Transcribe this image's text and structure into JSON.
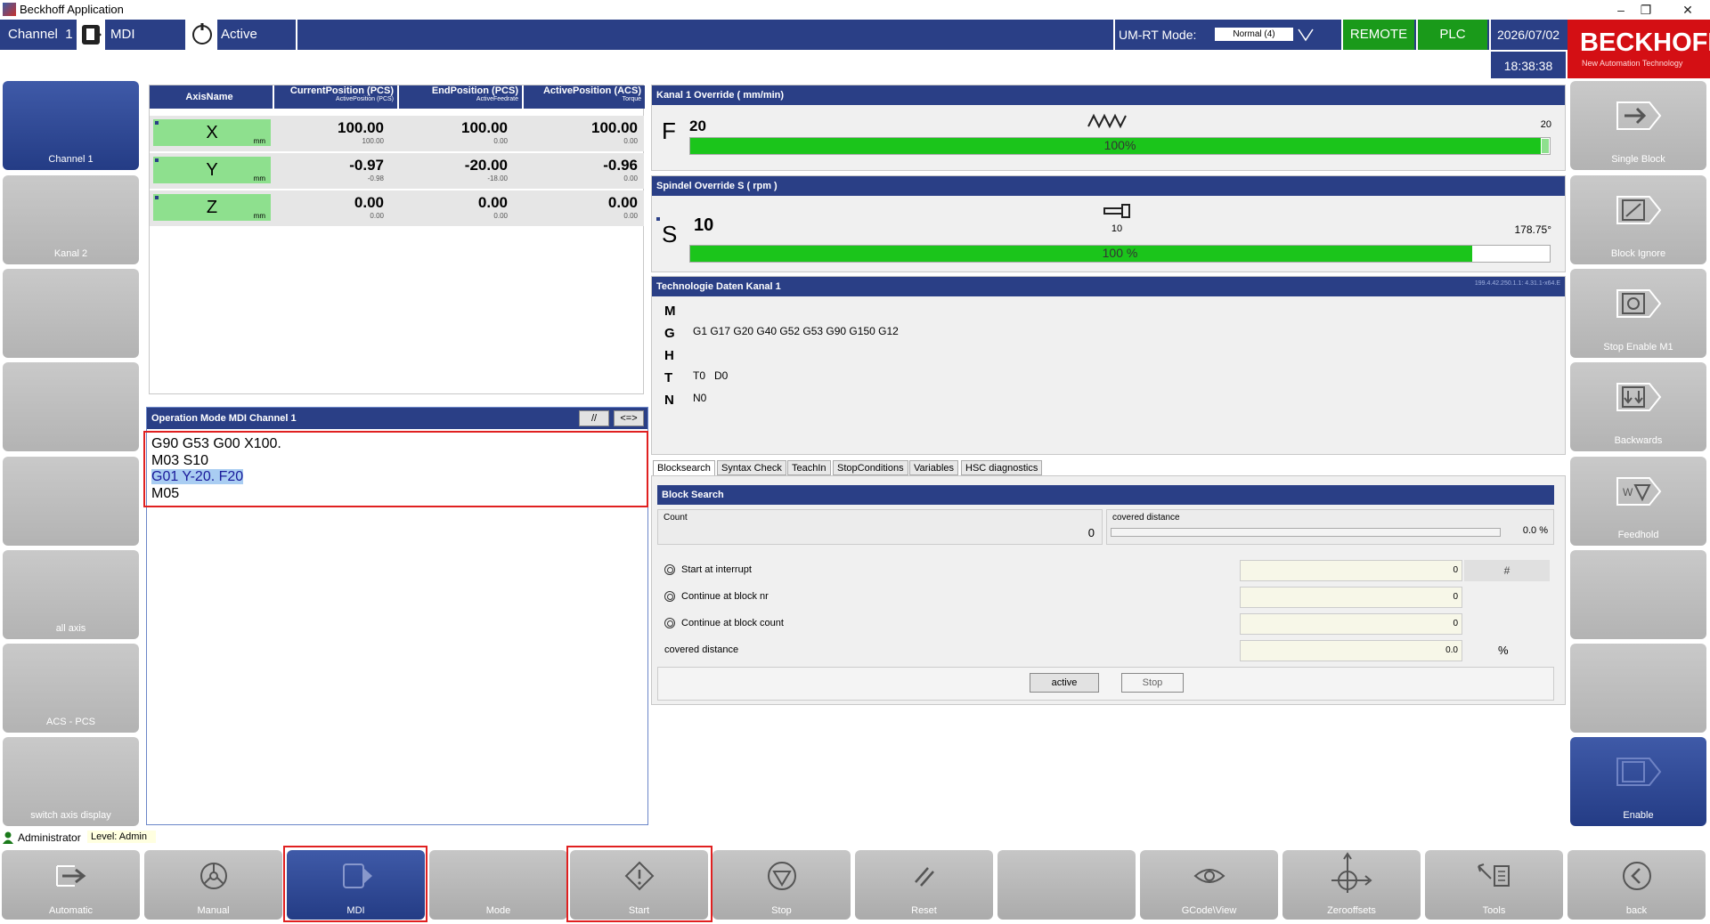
{
  "window": {
    "title": "Beckhoff Application",
    "minimize": "–",
    "maximize": "❐",
    "close": "✕"
  },
  "topbar": {
    "channel_label": "Channel",
    "channel_number": "1",
    "mode": "MDI",
    "state": "Active",
    "umrt_label": "UM-RT Mode:",
    "umrt_value": "Normal (4)",
    "remote": "REMOTE",
    "plc": "PLC",
    "date": "2026/07/02",
    "time": "18:38:38"
  },
  "logo": {
    "brand": "BECKHOFF",
    "tagline": "New Automation Technology"
  },
  "left_buttons": [
    "Channel 1",
    "Kanal 2",
    "",
    "",
    "",
    "all axis",
    "ACS - PCS",
    "switch axis display"
  ],
  "right_buttons": [
    "Single Block",
    "Block Ignore",
    "Stop Enable M1",
    "Backwards",
    "Feedhold",
    "",
    "",
    "Enable"
  ],
  "bottom_buttons": [
    "Automatic",
    "Manual",
    "MDI",
    "Mode",
    "Start",
    "Stop",
    "Reset",
    "",
    "GCode\\View",
    "Zerooffsets",
    "Tools",
    "back"
  ],
  "axis_table": {
    "headers": [
      {
        "main": "AxisName",
        "sub": ""
      },
      {
        "main": "CurrentPosition (PCS)",
        "sub": "ActivePosition (PCS)"
      },
      {
        "main": "EndPosition (PCS)",
        "sub": "ActiveFeedrate"
      },
      {
        "main": "ActivePosition (ACS)",
        "sub": "Torque"
      }
    ],
    "rows": [
      {
        "name": "X",
        "unit": "mm",
        "cur": "100.00",
        "cur_sub": "100.00",
        "end": "100.00",
        "end_sub": "0.00",
        "acs": "100.00",
        "acs_sub": "0.00"
      },
      {
        "name": "Y",
        "unit": "mm",
        "cur": "-0.97",
        "cur_sub": "-0.98",
        "end": "-20.00",
        "end_sub": "-18.00",
        "acs": "-0.96",
        "acs_sub": "0.00"
      },
      {
        "name": "Z",
        "unit": "mm",
        "cur": "0.00",
        "cur_sub": "0.00",
        "end": "0.00",
        "end_sub": "0.00",
        "acs": "0.00",
        "acs_sub": "0.00"
      }
    ]
  },
  "mdi": {
    "title": "Operation Mode MDI Channel 1",
    "btn_comment": "//",
    "btn_swap": "<=>",
    "lines": [
      "G90 G53 G00 X100.",
      "M03 S10",
      "G01 Y-20. F20",
      "M05"
    ],
    "highlight_line": 2
  },
  "feed_override": {
    "title": "Kanal 1 Override  ( mm/min)",
    "letter": "F",
    "value": "20",
    "right_value": "20",
    "percent_text": "100%",
    "fill": 0.99
  },
  "spindle_override": {
    "title": "Spindel Override S ( rpm     )",
    "letter": "S",
    "value": "10",
    "center_value": "10",
    "angle": "178.75°",
    "percent_text": "100 %",
    "fill": 0.91
  },
  "tech": {
    "title": "Technologie Daten Kanal 1",
    "version": "199.4.42.250.1.1: 4.31.1-x64.E",
    "rows": [
      {
        "label": "M",
        "value": ""
      },
      {
        "label": "G",
        "value": "G1 G17 G20 G40 G52 G53 G90 G150 G12"
      },
      {
        "label": "H",
        "value": ""
      },
      {
        "label": "T",
        "value": "T0   D0"
      },
      {
        "label": "N",
        "value": "N0"
      }
    ]
  },
  "tabs": [
    "Blocksearch",
    "Syntax Check",
    "TeachIn",
    "StopConditions",
    "Variables",
    "HSC diagnostics"
  ],
  "blocksearch": {
    "title": "Block Search",
    "count_label": "Count",
    "count_value": "0",
    "covered_label": "covered distance",
    "covered_value": "0.0 %",
    "options": [
      {
        "label": "Start at interrupt",
        "value": "0",
        "extra": "#"
      },
      {
        "label": "Continue at block nr",
        "value": "0",
        "extra": ""
      },
      {
        "label": "Continue at block count",
        "value": "0",
        "extra": ""
      }
    ],
    "covered_distance_label": "covered distance",
    "covered_distance_value": "0.0",
    "covered_distance_unit": "%",
    "btn_active": "active",
    "btn_stop": "Stop"
  },
  "status": {
    "user": "Administrator",
    "level": "Level: Admin"
  }
}
